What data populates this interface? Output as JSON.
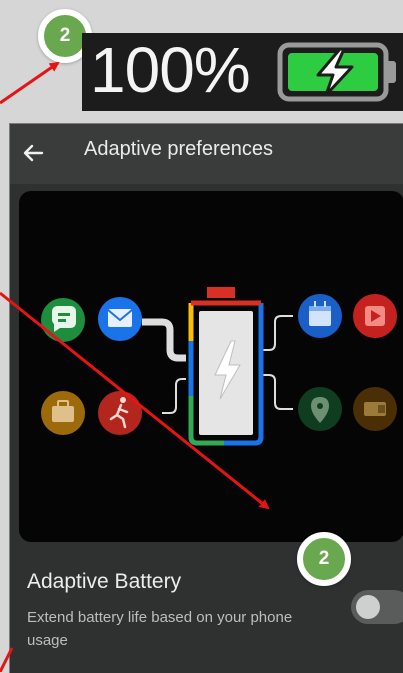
{
  "annotations": {
    "top_badge_number": "2",
    "bottom_badge_number": "2",
    "badge_color": "#6aa84f",
    "arrow_color": "#e61414"
  },
  "status_bar": {
    "battery_percent": "100%",
    "battery_icon": "battery-charging-icon",
    "battery_color": "#2ecc40"
  },
  "topbar": {
    "back_icon": "back-arrow-icon",
    "title": "Adaptive preferences"
  },
  "illustration": {
    "left_apps": [
      "messages-icon",
      "mail-icon",
      "briefcase-icon",
      "running-icon"
    ],
    "right_apps": [
      "calendar-icon",
      "video-icon",
      "maps-icon",
      "wallet-icon"
    ],
    "center": "battery-bolt-icon"
  },
  "setting": {
    "title": "Adaptive Battery",
    "description": "Extend battery life based on your phone usage",
    "toggle_on": false
  }
}
